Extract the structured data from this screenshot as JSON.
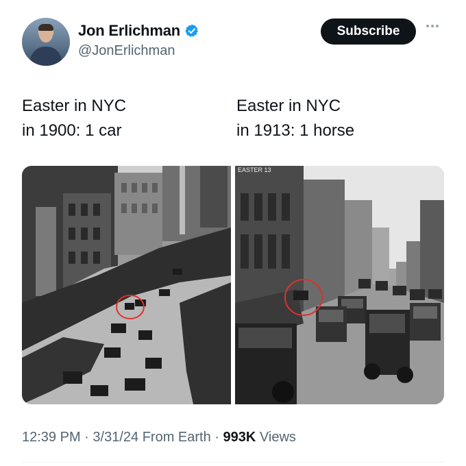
{
  "author": {
    "name": "Jon Erlichman",
    "handle": "@JonErlichman",
    "verified": true,
    "avatar_icon": "avatar-photo"
  },
  "actions": {
    "subscribe_label": "Subscribe",
    "more_icon": "more-horizontal-icon"
  },
  "post": {
    "left_caption": [
      "Easter in NYC",
      "in 1900: 1 car"
    ],
    "right_caption": [
      "Easter in NYC",
      "in 1913: 1 horse"
    ],
    "images": [
      {
        "desc": "black and white street crowded with horse carriages",
        "stamp": ""
      },
      {
        "desc": "black and white street crowded with cars",
        "stamp": "EASTER 13"
      }
    ]
  },
  "footer": {
    "time": "12:39 PM",
    "sep1": "·",
    "date": "3/31/24",
    "source": "From Earth",
    "sep2": "·",
    "views_count": "993K",
    "views_label": "Views"
  },
  "colors": {
    "text": "#0f1419",
    "secondary": "#536471",
    "verified_blue": "#1d9bf0",
    "highlight_circle": "#e0302a"
  }
}
